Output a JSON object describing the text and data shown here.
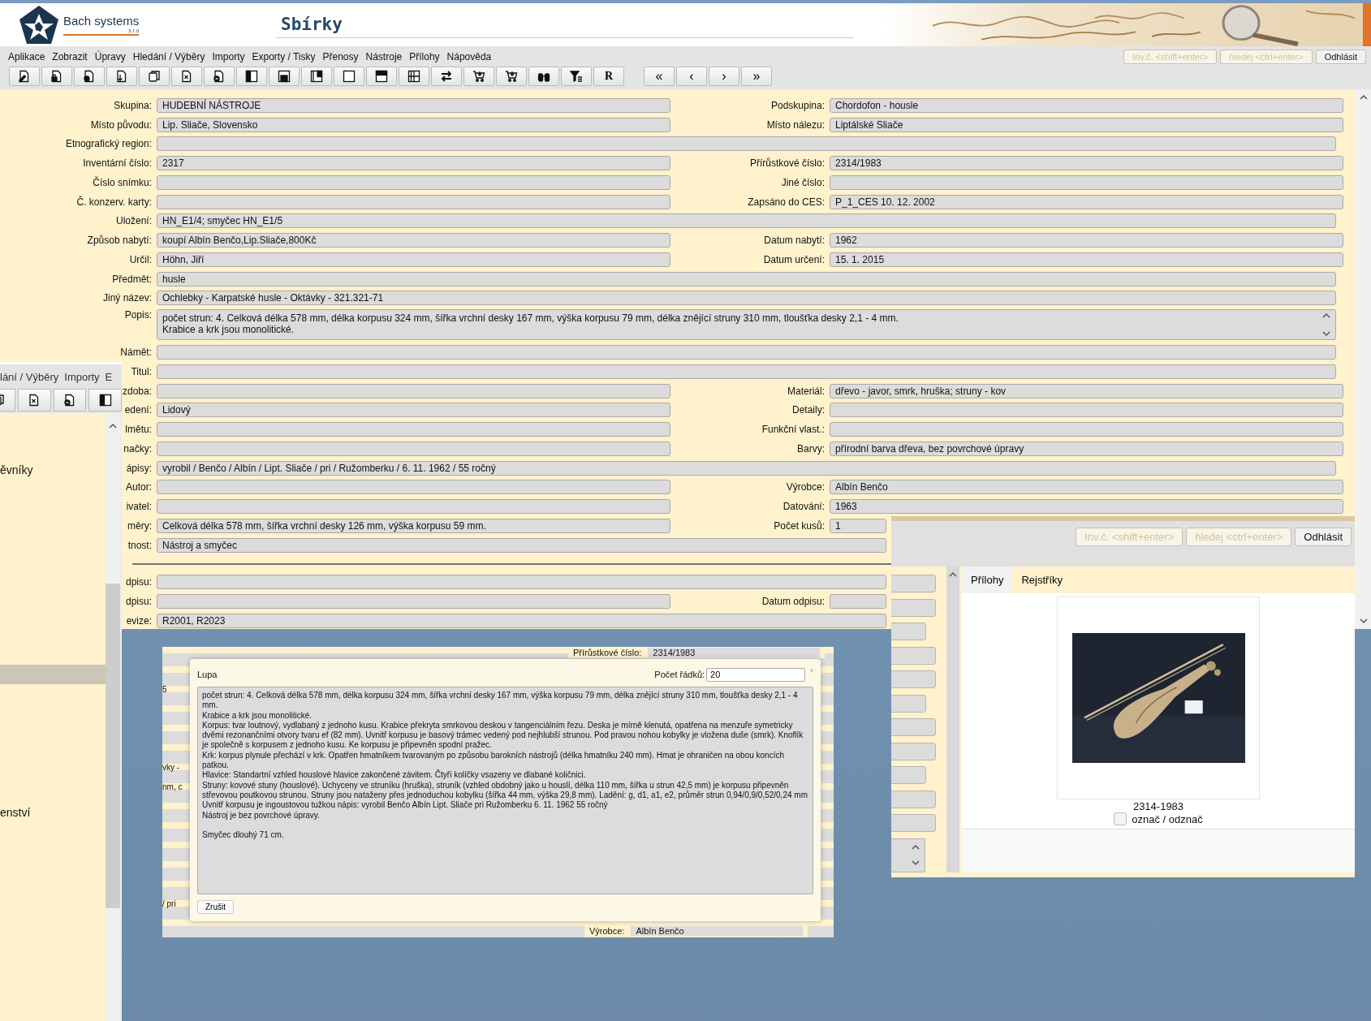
{
  "header": {
    "company": "Bach systems",
    "company_suffix": "s.r.o",
    "title": "Sbírky",
    "buttons": [
      {
        "label": "Inv.č. <shift+enter>",
        "disabled": true
      },
      {
        "label": "hledej <ctrl+enter>",
        "disabled": true
      },
      {
        "label": "Odhlásit",
        "disabled": false
      }
    ]
  },
  "menu": [
    "Aplikace",
    "Zobrazit",
    "Úpravy",
    "Hledání / Výběry",
    "Importy",
    "Exporty / Tisky",
    "Přenosy",
    "Nástroje",
    "Přílohy",
    "Nápověda"
  ],
  "toolbar": {
    "text_buttons": [
      "R",
      "«",
      "‹",
      "›",
      "»"
    ]
  },
  "form": {
    "rows": [
      {
        "kind": "pair",
        "left": {
          "label": "Skupina:",
          "value": "HUDEBNÍ NÁSTROJE"
        },
        "right": {
          "label": "Podskupina:",
          "value": "Chordofon - housle"
        }
      },
      {
        "kind": "pair",
        "left": {
          "label": "Místo původu:",
          "value": "Lip. Sliače, Slovensko"
        },
        "right": {
          "label": "Místo nálezu:",
          "value": "Liptálské Sliače"
        }
      },
      {
        "kind": "full",
        "left": {
          "label": "Etnografický region:"
        }
      },
      {
        "kind": "pair",
        "left": {
          "label": "Inventární číslo:",
          "value": "2317"
        },
        "right": {
          "label": "Přírůstkové číslo:",
          "value": "2314/1983"
        }
      },
      {
        "kind": "pair",
        "left": {
          "label": "Číslo snímku:"
        },
        "right": {
          "label": "Jiné číslo:"
        }
      },
      {
        "kind": "pair",
        "left": {
          "label": "Č. konzerv. karty:"
        },
        "right": {
          "label": "Zapsáno do CES:",
          "value": "P_1_CES 10. 12. 2002"
        }
      },
      {
        "kind": "full",
        "left": {
          "label": "Uložení:",
          "value": "HN_E1/4; smyčec HN_E1/5"
        }
      },
      {
        "kind": "pair",
        "left": {
          "label": "Způsob nabytí:",
          "value": "koupí Albín Benčo,Lip.Sliače,800Kč"
        },
        "right": {
          "label": "Datum nabytí:",
          "value": "1962"
        }
      },
      {
        "kind": "pair",
        "left": {
          "label": "Určil:",
          "value": "Höhn, Jiří"
        },
        "right": {
          "label": "Datum určení:",
          "value": "15. 1. 2015"
        }
      },
      {
        "kind": "full",
        "left": {
          "label": "Předmět:",
          "value": "husle"
        }
      },
      {
        "kind": "full",
        "left": {
          "label": "Jiný název:",
          "value": "Ochlebky - Karpatské husle - Oktávky - 321.321-71"
        }
      },
      {
        "kind": "textarea",
        "left": {
          "label": "Popis:",
          "lines": [
            "počet strun: 4. Celková délka 578 mm, délka korpusu 324 mm, šířka vrchní desky 167 mm, výška korpusu 79 mm, délka znějící struny 310 mm, tloušťka desky 2,1 - 4 mm.",
            "Krabice a krk jsou monolitické."
          ]
        }
      },
      {
        "kind": "full",
        "left": {
          "label": "Námět:"
        }
      },
      {
        "kind": "full",
        "left": {
          "label": "Titul:"
        }
      },
      {
        "kind": "pair",
        "left": {
          "label": "zdoba:"
        },
        "right": {
          "label": "Materiál:",
          "value": "dřevo - javor, smrk, hruška; struny - kov"
        }
      },
      {
        "kind": "pair",
        "left": {
          "label": "edení:",
          "value": "Lidový"
        },
        "right": {
          "label": "Detaily:"
        }
      },
      {
        "kind": "pair",
        "left": {
          "label": "lmětu:"
        },
        "right": {
          "label": "Funkční vlast.:"
        }
      },
      {
        "kind": "pair",
        "left": {
          "label": "načky:"
        },
        "right": {
          "label": "Barvy:",
          "value": "přírodní barva dřeva, bez povrchové úpravy"
        }
      },
      {
        "kind": "full",
        "left": {
          "label": "ápisy:",
          "value": "vyrobil / Benčo / Albín / Lipt. Sliače / pri / Ružomberku / 6. 11. 1962 / 55 ročný"
        }
      },
      {
        "kind": "pair",
        "left": {
          "label": "Autor:"
        },
        "right": {
          "label": "Výrobce:",
          "value": "Albín Benčo"
        }
      },
      {
        "kind": "pair",
        "left": {
          "label": "ivatel:"
        },
        "right": {
          "label": "Datování:",
          "value": "1963"
        }
      },
      {
        "kind": "pair",
        "left": {
          "label": "měry:",
          "value": "Celková délka 578 mm, šířka vrchní desky 126 mm, výška korpusu 59 mm."
        },
        "right": {
          "label": "Počet kusů:",
          "value": "1"
        }
      },
      {
        "kind": "full",
        "left": {
          "label": "tnost:",
          "value": "Nástroj a smyčec"
        }
      },
      {
        "kind": "divider"
      },
      {
        "kind": "full",
        "left": {
          "label": "dpisu:"
        }
      },
      {
        "kind": "pair",
        "left": {
          "label": "dpisu:"
        },
        "right": {
          "label": "Datum odpisu:"
        }
      },
      {
        "kind": "full",
        "left": {
          "label": "evize:",
          "value": "R2001, R2023"
        }
      }
    ]
  },
  "left_window": {
    "menu": [
      "lání / Výběry",
      "Importy",
      "E"
    ],
    "texts": [
      "ěvníky",
      "enství"
    ]
  },
  "background_form": {
    "top": {
      "label": "Přírůstkové číslo:",
      "value": "2314/1983"
    },
    "bottom": {
      "label": "Výrobce:",
      "value": "Albín Benčo"
    },
    "fragments": [
      "5",
      "vky -",
      "nm, c",
      "/ pri"
    ]
  },
  "dialog": {
    "title": "Lupa",
    "rows_label": "Počet řádků:",
    "rows_value": "20",
    "required_mark": "*",
    "blocks": [
      [
        "počet strun: 4. Celková délka 578 mm, délka korpusu 324 mm, šířka vrchní desky 167 mm, výška korpusu 79 mm, délka znějící struny 310 mm, tloušťka desky 2,1 - 4 mm.",
        "Krabice a krk jsou monolitické.",
        "Korpus: tvar loutnový, vydlabaný z jednoho kusu. Krabice překryta smrkovou deskou v tangenciálním řezu. Deska je mírně klenutá, opatřena na menzuře symetricky dvěmi rezonančními otvory tvaru ef (82 mm). Uvnitř korpusu je basový trámec vedený pod nejhlubší strunou. Pod pravou nohou kobylky je vložena duše (smrk). Knoflík je společně s korpusem z jednoho kusu. Ke korpusu je připevněn spodní pražec.",
        "Krk: korpus plynule přechází v krk. Opatřen hmatníkem tvarovaným po způsobu barokních nástrojů (délka hmatníku 240 mm). Hmat je ohraničen na obou koncích patkou.",
        "Hlavice: Standartní vzhled houslové hlavice zakončené závitem. Čtyři kolíčky vsazeny ve dlabané količnici.",
        "Struny: kovové stuny (houslové). Uchyceny ve struníku (hruška), struník (vzhled obdobný jako u houslí, délka 110 mm, šířka u strun 42,5 mm) je korpusu připevněn střevovou poutkovou strunou. Struny jsou nataženy přes jednoduchou kobylku (šířka 44 mm, výška 29,8 mm). Ladění: g, d1, a1, e2, průměr strun 0,94/0,9/0,52/0,24 mm",
        "Uvnitř korpusu je ingoustovou tužkou nápis: vyrobil Benčo Albín Lipt. Sliače pri Ružomberku 6. 11. 1962 55 ročný",
        "Nástroj je bez povrchové úpravy."
      ],
      [
        "Smyčec dlouhý 71 cm."
      ]
    ],
    "cancel": "Zrušit"
  },
  "attachments_window": {
    "buttons": [
      {
        "label": "Inv.č. <shift+enter>",
        "disabled": true
      },
      {
        "label": "hledej <ctrl+enter>",
        "disabled": true
      },
      {
        "label": "Odhlásit",
        "disabled": false
      }
    ],
    "tabs": [
      {
        "label": "Přílohy",
        "selected": true
      },
      {
        "label": "Rejstříky",
        "selected": false
      }
    ],
    "attachment": {
      "kind": "picture",
      "caption": "2314-1983",
      "checkbox_label": "označ / odznač",
      "checked": false
    }
  }
}
